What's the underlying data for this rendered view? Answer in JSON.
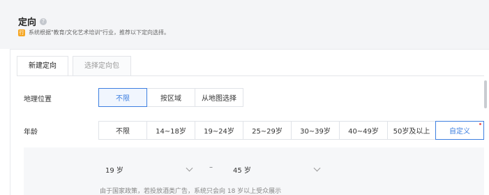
{
  "header": {
    "title": "定向",
    "info_icon": "?",
    "hint_badge": "行",
    "hint_text": "系统根据\"教育/文化艺术培训\"行业，推荐以下定向选择。"
  },
  "tabs": [
    {
      "label": "新建定向",
      "active": true
    },
    {
      "label": "选择定向包",
      "active": false
    }
  ],
  "location": {
    "label": "地理位置",
    "options": [
      "不限",
      "按区域",
      "从地图选择"
    ],
    "selected": "不限"
  },
  "age": {
    "label": "年龄",
    "options": [
      "不限",
      "14~18岁",
      "19~24岁",
      "25~29岁",
      "30~39岁",
      "40~49岁",
      "50岁及以上",
      "自定义"
    ],
    "selected": "自定义"
  },
  "custom_age": {
    "from_value": "19 岁",
    "separator": "–",
    "to_value": "45 岁",
    "note": "由于国家政策，若投放酒类广告，系统只会向 18 岁以上受众展示"
  },
  "colors": {
    "accent": "#3d7fe0",
    "badge": "#f5a623",
    "dot": "#f05a5a"
  }
}
